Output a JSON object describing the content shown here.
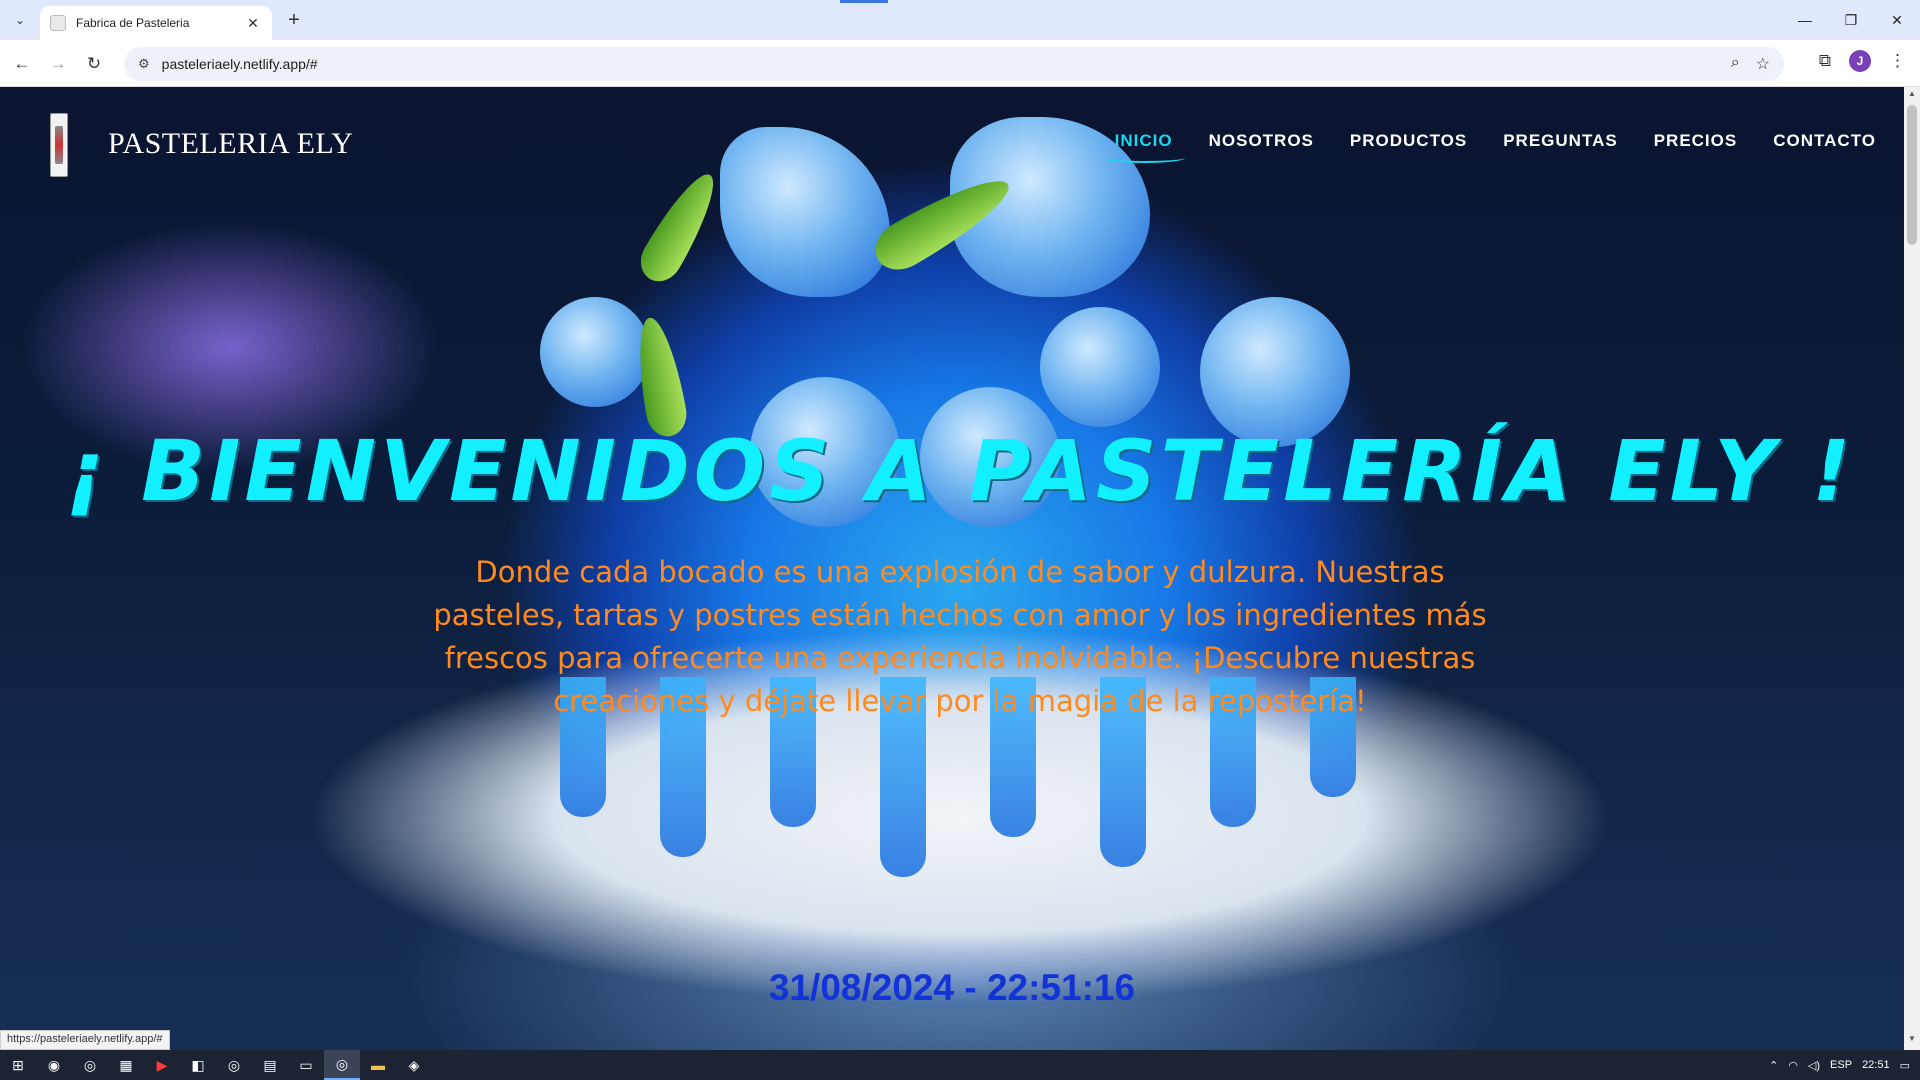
{
  "browser": {
    "tab_title": "Fabrica de Pasteleria",
    "url": "pasteleriaely.netlify.app/#",
    "profile_initial": "J",
    "status_url": "https://pasteleriaely.netlify.app/#"
  },
  "site": {
    "brand": "PASTELERIA ELY",
    "menu": [
      {
        "label": "INICIO",
        "active": true
      },
      {
        "label": "NOSOTROS",
        "active": false
      },
      {
        "label": "PRODUCTOS",
        "active": false
      },
      {
        "label": "PREGUNTAS",
        "active": false
      },
      {
        "label": "PRECIOS",
        "active": false
      },
      {
        "label": "CONTACTO",
        "active": false
      }
    ],
    "hero_title": "¡ BIENVENIDOS A PASTELERÍA ELY !",
    "hero_subtitle": "Donde cada bocado es una explosión de sabor y dulzura. Nuestras pasteles, tartas y postres están hechos con amor y los ingredientes más frescos para ofrecerte una experiencia inolvidable. ¡Descubre nuestras creaciones y déjate llevar por la magia de la repostería!",
    "datetime": "31/08/2024 - 22:51:16"
  },
  "colors": {
    "active_menu": "#19d8ef",
    "hero_title": "#12f0ff",
    "hero_subtitle": "#ff8a1d",
    "clock": "#1234d6"
  },
  "taskbar": {
    "language": "ESP",
    "time": "22:51"
  }
}
